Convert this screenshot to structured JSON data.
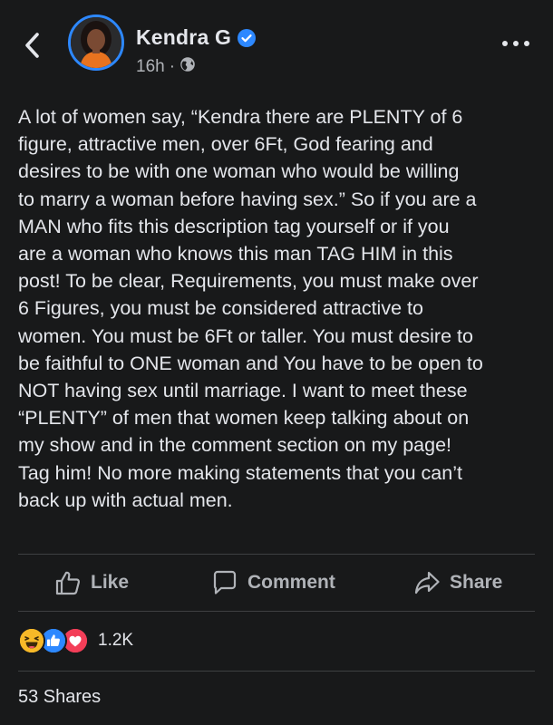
{
  "author": {
    "name": "Kendra G",
    "verified": true,
    "time": "16h",
    "separator": "·",
    "privacy_icon": "globe-icon"
  },
  "post": {
    "text": "A lot of women say, “Kendra there are PLENTY of 6\nfigure, attractive men, over 6Ft, God fearing and\ndesires to be with one woman who would be willing\nto marry a woman before having sex.” So if you are a\nMAN who fits this description tag yourself or if you\nare a woman who knows this man TAG HIM in this\npost! To be clear, Requirements, you must make over\n6 Figures, you must be considered attractive to\nwomen. You must be 6Ft or taller. You must desire to\nbe faithful to ONE woman and You have to be open to\nNOT having sex until marriage. I want to meet these\n“PLENTY” of men that women keep talking about on\nmy show and in the comment section on my page!\nTag him! No more making statements that you can’t\nback up with actual men."
  },
  "actions": {
    "like": "Like",
    "comment": "Comment",
    "share": "Share"
  },
  "reactions": {
    "icons": [
      "haha-icon",
      "like-icon",
      "love-icon"
    ],
    "count": "1.2K"
  },
  "shares": "53 Shares",
  "colors": {
    "background": "#18191a",
    "text": "#e4e6eb",
    "secondary_text": "#b0b3b8",
    "accent": "#2d88ff",
    "love": "#f33e58",
    "haha": "#f7b928"
  }
}
